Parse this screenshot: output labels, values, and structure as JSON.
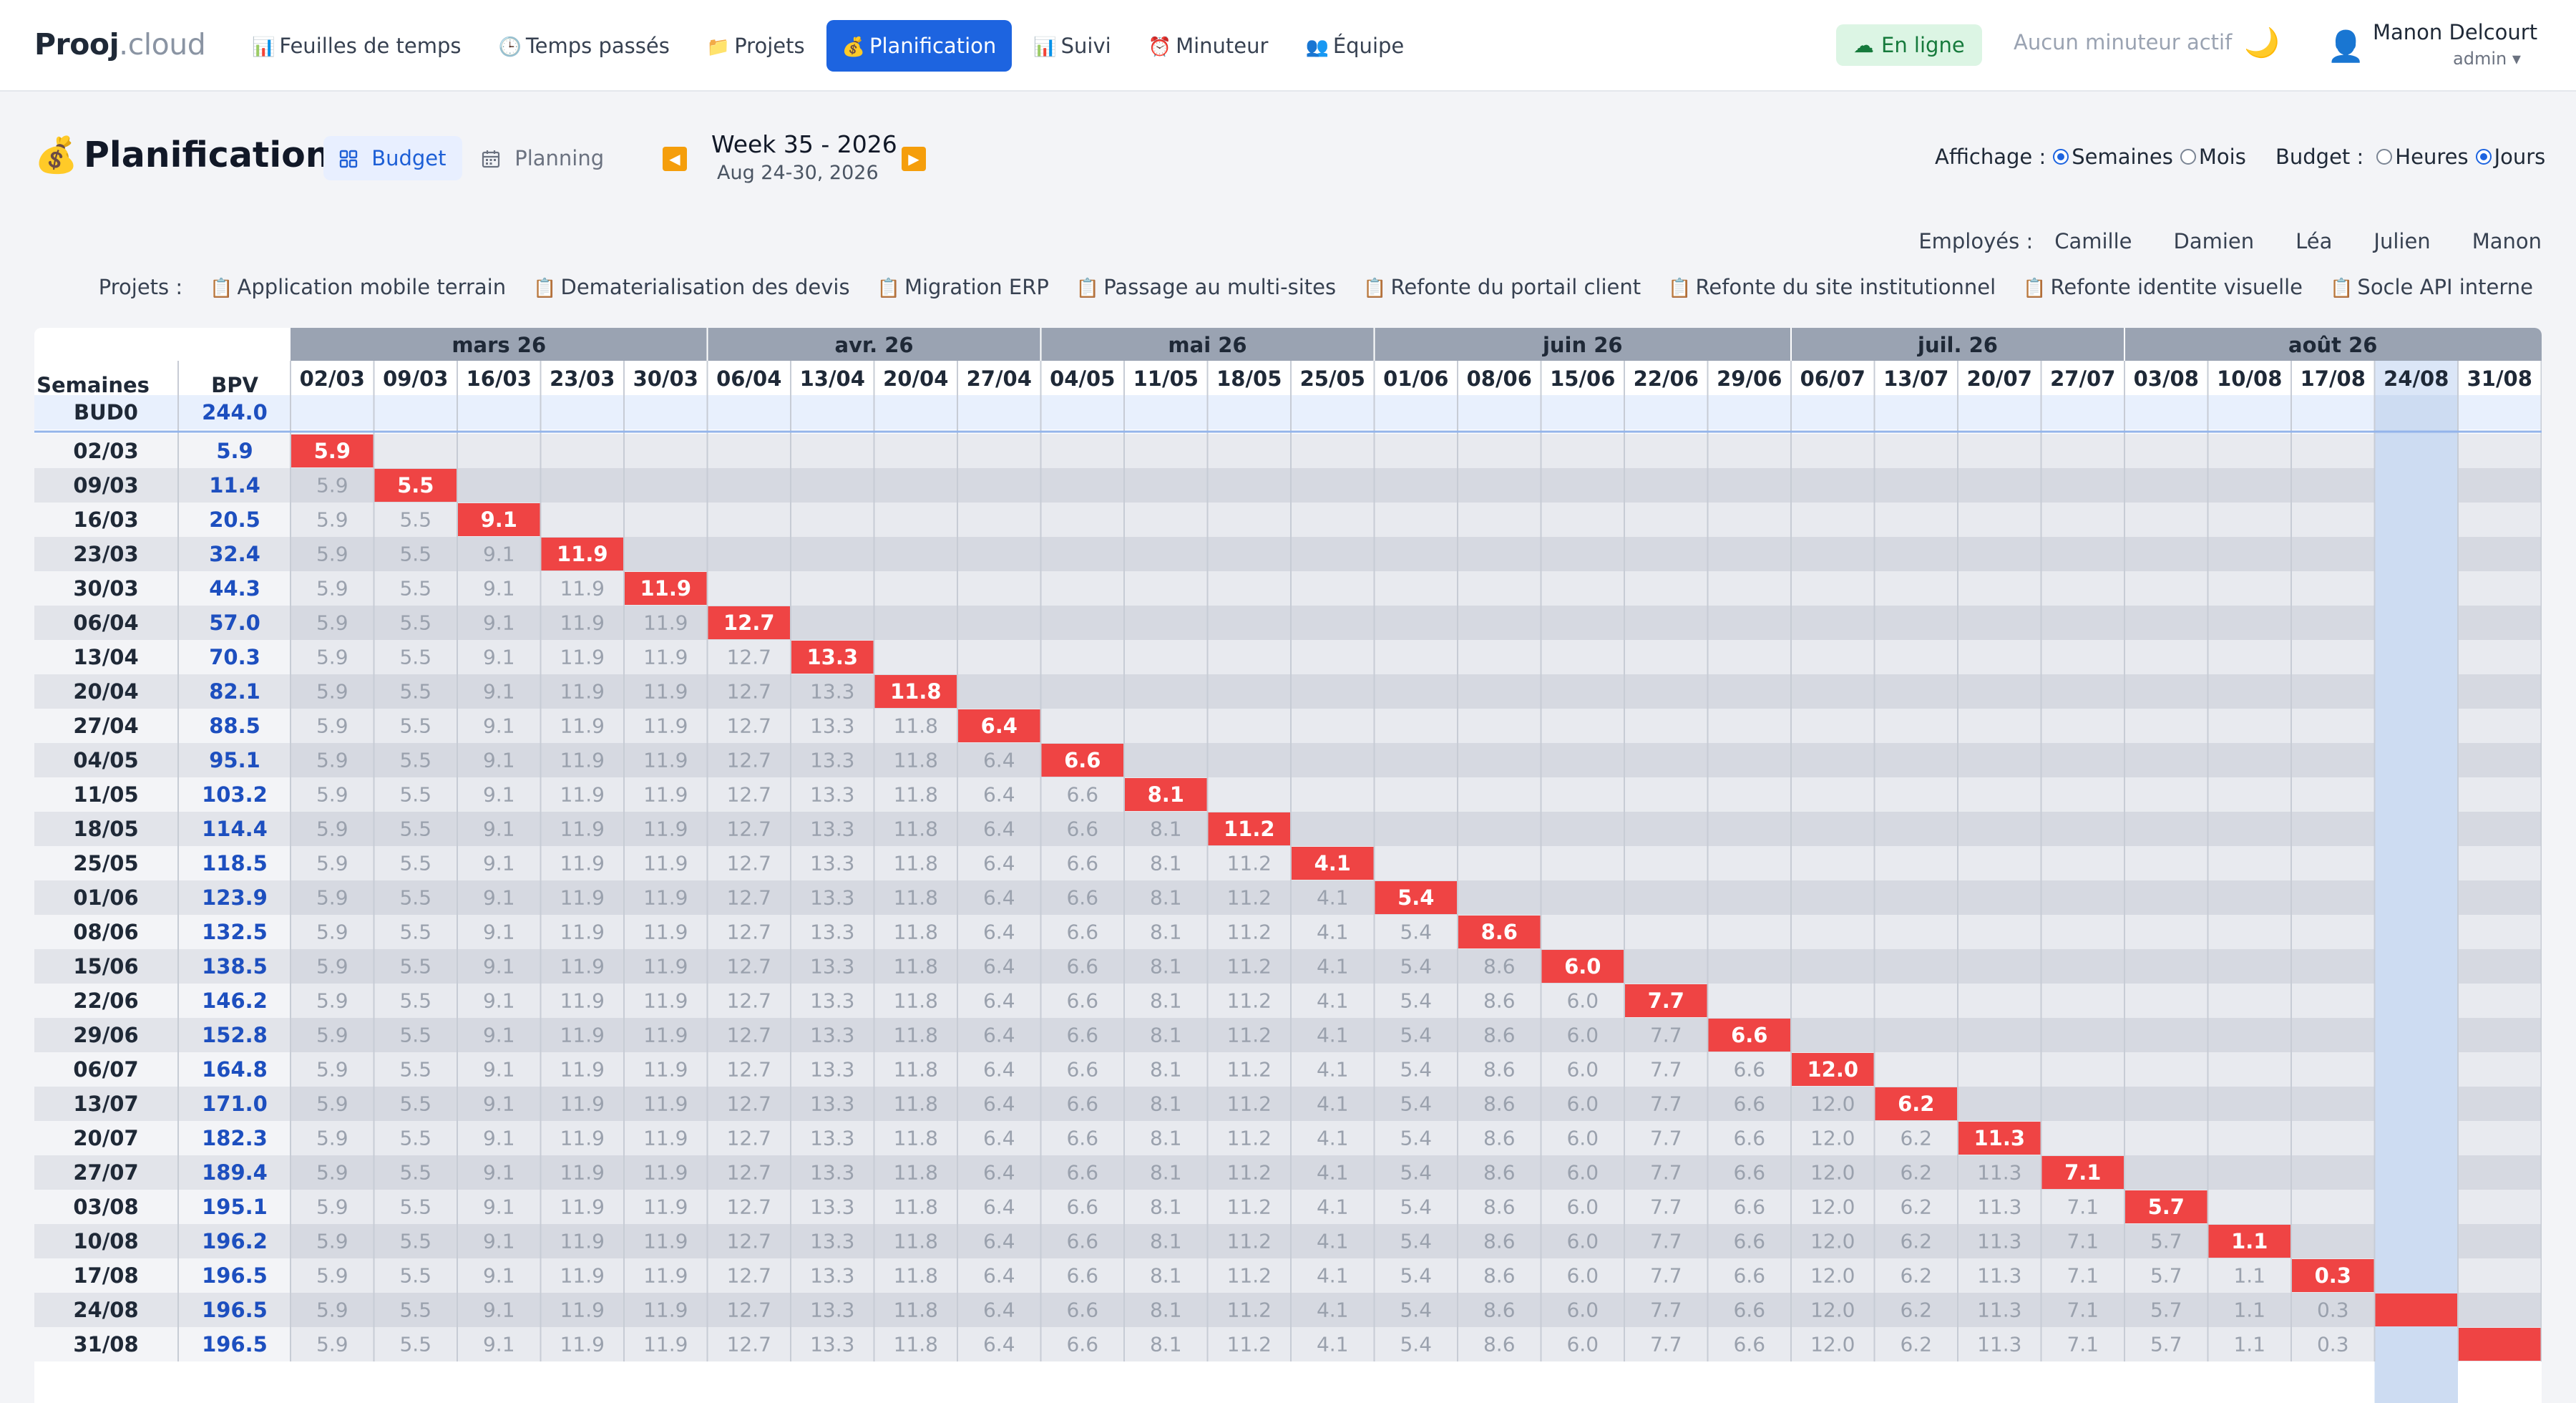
{
  "app": {
    "brand": "Prooj",
    "tld": ".cloud"
  },
  "nav": [
    {
      "icon": "📊",
      "label": "Feuilles de temps"
    },
    {
      "icon": "🕒",
      "label": "Temps passés"
    },
    {
      "icon": "📁",
      "label": "Projets"
    },
    {
      "icon": "💰",
      "label": "Planification",
      "active": true
    },
    {
      "icon": "📊",
      "label": "Suivi"
    },
    {
      "icon": "⏰",
      "label": "Minuteur"
    },
    {
      "icon": "👥",
      "label": "Équipe"
    }
  ],
  "header": {
    "status": "En ligne",
    "timer": "Aucun minuteur actif",
    "user_name": "Manon Delcourt",
    "user_role": "admin ▾"
  },
  "page": {
    "title": "Planification",
    "tab_budget": "Budget",
    "tab_planning": "Planning",
    "week_title": "Week 35 - 2026",
    "week_range": "Aug 24-30, 2026",
    "affichage_label": "Affichage :",
    "affichage_options": [
      "Semaines",
      "Mois"
    ],
    "affichage_selected": "Semaines",
    "budget_label": "Budget :",
    "budget_options": [
      "Heures",
      "Jours"
    ],
    "budget_selected": "Jours",
    "employes_label": "Employés :",
    "employes": [
      "Camille",
      "Damien",
      "Léa",
      "Julien",
      "Manon"
    ],
    "projets_label": "Projets :",
    "projets": [
      "Application mobile terrain",
      "Dematerialisation des devis",
      "Migration ERP",
      "Passage au multi-sites",
      "Refonte du portail client",
      "Refonte du site institutionnel",
      "Refonte identite visuelle",
      "Socle API interne"
    ]
  },
  "colors": {
    "accent": "#1d64e0",
    "diagonal": "#ef4444",
    "month_header": "#9aa3b2",
    "current_week": "#cddcf2",
    "bpv_text": "#1d4fbf"
  },
  "chart_data": {
    "type": "table",
    "row_header": "Semaines",
    "bpv_header": "BPV",
    "months": [
      {
        "label": "mars 26",
        "span": 5
      },
      {
        "label": "avr. 26",
        "span": 4
      },
      {
        "label": "mai 26",
        "span": 4
      },
      {
        "label": "juin 26",
        "span": 5
      },
      {
        "label": "juil. 26",
        "span": 4
      },
      {
        "label": "août 26",
        "span": 5
      }
    ],
    "weeks": [
      "02/03",
      "09/03",
      "16/03",
      "23/03",
      "30/03",
      "06/04",
      "13/04",
      "20/04",
      "27/04",
      "04/05",
      "11/05",
      "18/05",
      "25/05",
      "01/06",
      "08/06",
      "15/06",
      "22/06",
      "29/06",
      "06/07",
      "13/07",
      "20/07",
      "27/07",
      "03/08",
      "10/08",
      "17/08",
      "24/08",
      "31/08"
    ],
    "current_week": "24/08",
    "budget_row": {
      "label": "BUD0",
      "value": "244.0"
    },
    "bpv": [
      "5.9",
      "11.4",
      "20.5",
      "32.4",
      "44.3",
      "57.0",
      "70.3",
      "82.1",
      "88.5",
      "95.1",
      "103.2",
      "114.4",
      "118.5",
      "123.9",
      "132.5",
      "138.5",
      "146.2",
      "152.8",
      "164.8",
      "171.0",
      "182.3",
      "189.4",
      "195.1",
      "196.2",
      "196.5",
      "196.5",
      "196.5"
    ],
    "weekly_values": [
      "5.9",
      "5.5",
      "9.1",
      "11.9",
      "11.9",
      "12.7",
      "13.3",
      "11.8",
      "6.4",
      "6.6",
      "8.1",
      "11.2",
      "4.1",
      "5.4",
      "8.6",
      "6.0",
      "7.7",
      "6.6",
      "12.0",
      "6.2",
      "11.3",
      "7.1",
      "5.7",
      "1.1",
      "0.3",
      "",
      ""
    ]
  }
}
